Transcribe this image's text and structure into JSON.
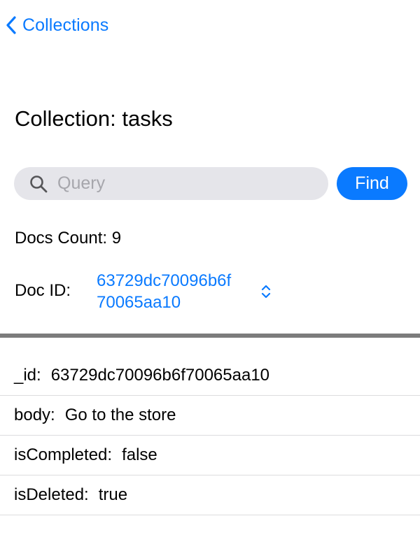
{
  "nav": {
    "back_label": "Collections",
    "back_icon": "chevron-left-icon"
  },
  "page": {
    "title": "Collection: tasks"
  },
  "search": {
    "placeholder": "Query",
    "value": "",
    "icon": "search-icon",
    "find_label": "Find"
  },
  "stats": {
    "docs_count_label": "Docs Count: 9"
  },
  "doc_picker": {
    "label": "Doc ID:",
    "value_line1": "63729dc70096b6f",
    "value_line2": "70065aa10",
    "icon": "chevron-up-down-icon"
  },
  "document": {
    "fields": [
      {
        "key": "_id:",
        "value": "63729dc70096b6f70065aa10"
      },
      {
        "key": "body:",
        "value": "Go to the store"
      },
      {
        "key": "isCompleted:",
        "value": "false"
      },
      {
        "key": "isDeleted:",
        "value": "true"
      }
    ]
  },
  "colors": {
    "accent": "#0a7aff",
    "search_background": "#e5e5ea",
    "divider": "#7c7c7c"
  }
}
